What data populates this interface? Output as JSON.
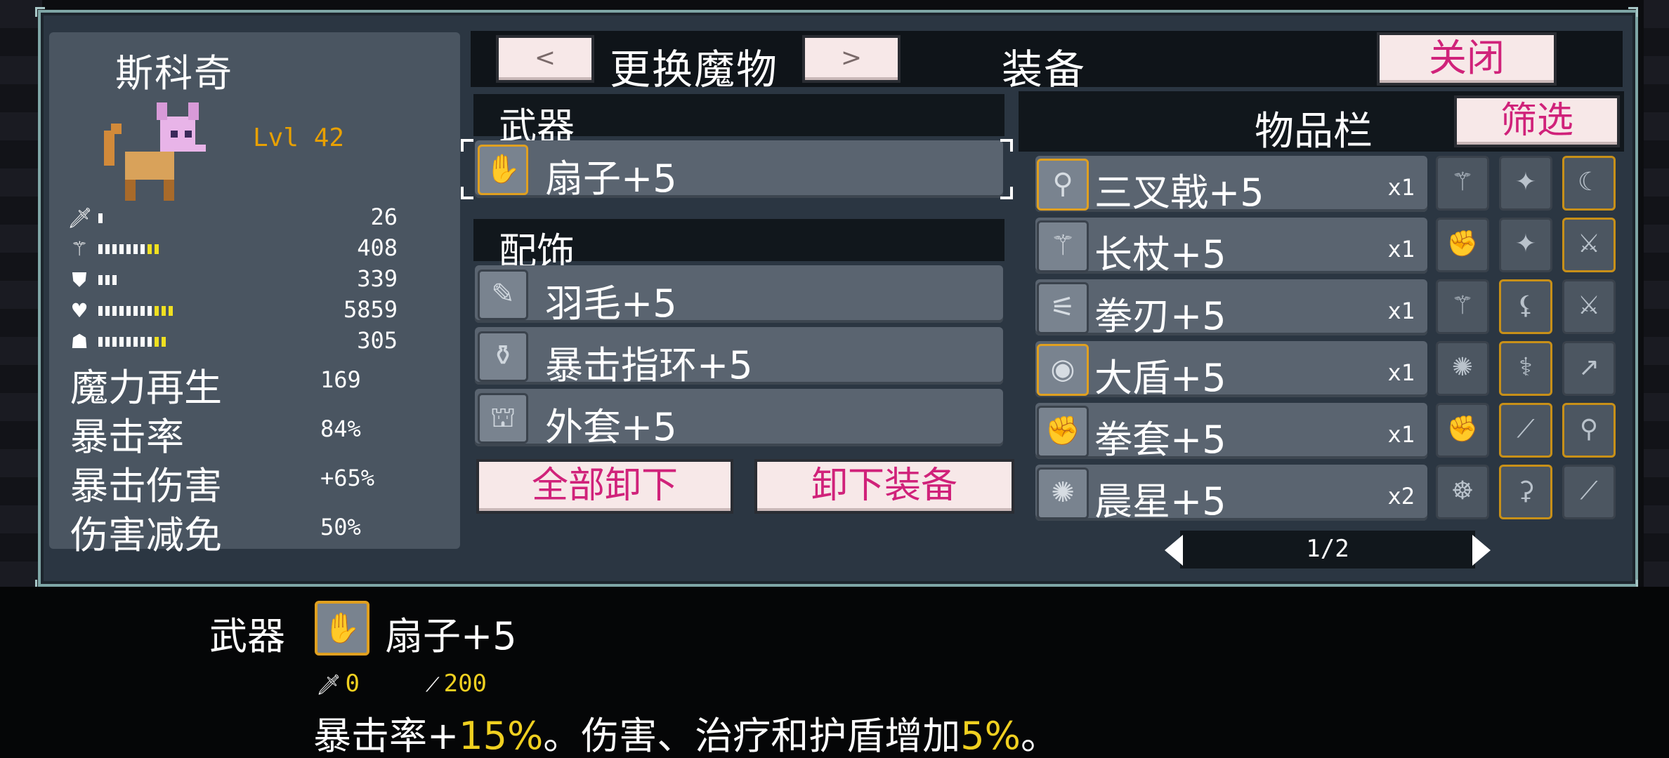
{
  "monster": {
    "name": "斯科奇",
    "level": "Lvl 42",
    "stats": [
      {
        "icon": "sword-icon",
        "glyph": "🗡",
        "value": "26",
        "white_bars": 1,
        "yellow_bars": 0
      },
      {
        "icon": "staff-icon",
        "glyph": "⚚",
        "value": "408",
        "white_bars": 7,
        "yellow_bars": 2
      },
      {
        "icon": "shield-icon",
        "glyph": "⛊",
        "value": "339",
        "white_bars": 3,
        "yellow_bars": 0
      },
      {
        "icon": "heart-icon",
        "glyph": "♥",
        "value": "5859",
        "white_bars": 8,
        "yellow_bars": 3
      },
      {
        "icon": "mana-icon",
        "glyph": "☗",
        "value": "305",
        "white_bars": 8,
        "yellow_bars": 2
      }
    ],
    "extra_stats": [
      {
        "label": "魔力再生",
        "value": "169"
      },
      {
        "label": "暴击率",
        "value": "84%"
      },
      {
        "label": "暴击伤害",
        "value": "+65%"
      },
      {
        "label": "伤害减免",
        "value": "50%"
      }
    ]
  },
  "header": {
    "prev_label": "<",
    "change_label": "更换魔物",
    "next_label": ">",
    "equipment_title": "装备",
    "close_label": "关闭"
  },
  "equipment": {
    "weapon_title": "武器",
    "weapon": {
      "name": "扇子+5",
      "icon": "fan-icon",
      "glyph": "✋"
    },
    "accessory_title": "配饰",
    "accessories": [
      {
        "name": "羽毛+5",
        "icon": "feather-icon",
        "glyph": "✎"
      },
      {
        "name": "暴击指环+5",
        "icon": "ring-icon",
        "glyph": "⚱"
      },
      {
        "name": "外套+5",
        "icon": "coat-icon",
        "glyph": "⛫"
      }
    ],
    "unequip_all_label": "全部卸下",
    "unequip_label": "卸下装备"
  },
  "inventory": {
    "title": "物品栏",
    "filter_label": "筛选",
    "items": [
      {
        "name": "三叉戟+5",
        "qty": "x1",
        "icon": "trident-icon",
        "glyph": "⚲",
        "selected": true
      },
      {
        "name": "长杖+5",
        "qty": "x1",
        "icon": "staff-icon",
        "glyph": "⚚",
        "selected": false
      },
      {
        "name": "拳刃+5",
        "qty": "x1",
        "icon": "claw-icon",
        "glyph": "⚟",
        "selected": false
      },
      {
        "name": "大盾+5",
        "qty": "x1",
        "icon": "round-shield-icon",
        "glyph": "◉",
        "selected": true
      },
      {
        "name": "拳套+5",
        "qty": "x1",
        "icon": "gauntlet-icon",
        "glyph": "✊",
        "selected": false
      },
      {
        "name": "晨星+5",
        "qty": "x2",
        "icon": "morningstar-icon",
        "glyph": "✺",
        "selected": false
      }
    ],
    "side_slots": [
      [
        {
          "icon": "staff-icon",
          "glyph": "⚚",
          "gold": false
        },
        {
          "icon": "shuriken-icon",
          "glyph": "✦",
          "gold": false
        },
        {
          "icon": "horn-icon",
          "glyph": "☾",
          "gold": true
        }
      ],
      [
        {
          "icon": "gauntlet-icon",
          "glyph": "✊",
          "gold": false
        },
        {
          "icon": "shuriken-icon",
          "glyph": "✦",
          "gold": false
        },
        {
          "icon": "sword-icon",
          "glyph": "⚔",
          "gold": true
        }
      ],
      [
        {
          "icon": "staff-icon",
          "glyph": "⚚",
          "gold": false
        },
        {
          "icon": "scythe-icon",
          "glyph": "⚸",
          "gold": true
        },
        {
          "icon": "sword-icon",
          "glyph": "⚔",
          "gold": false
        }
      ],
      [
        {
          "icon": "morningstar-icon",
          "glyph": "✺",
          "gold": false
        },
        {
          "icon": "dagger-icon",
          "glyph": "⚕",
          "gold": true
        },
        {
          "icon": "spear-icon",
          "glyph": "↗",
          "gold": false
        }
      ],
      [
        {
          "icon": "gauntlet-icon",
          "glyph": "✊",
          "gold": false
        },
        {
          "icon": "wand-icon",
          "glyph": "⟋",
          "gold": true
        },
        {
          "icon": "mace-icon",
          "glyph": "⚲",
          "gold": true
        }
      ],
      [
        {
          "icon": "octopus-icon",
          "glyph": "☸",
          "gold": false
        },
        {
          "icon": "cane-icon",
          "glyph": "⚳",
          "gold": true
        },
        {
          "icon": "wand-icon",
          "glyph": "⟋",
          "gold": false
        }
      ]
    ],
    "page": "1/2"
  },
  "tooltip": {
    "slot_label": "武器",
    "item_name": "扇子+5",
    "stat_attack": "0",
    "stat_magic": "200",
    "desc_part1": "暴击率+",
    "desc_hl1": "15%",
    "desc_part2": "。伤害、治疗和护盾增加",
    "desc_hl2": "5%",
    "desc_part3": "。"
  },
  "colors": {
    "accent_pink": "#d0227a",
    "gold_border": "#e0a020",
    "highlight_yellow": "#f0d020",
    "level_orange": "#e8a000"
  }
}
